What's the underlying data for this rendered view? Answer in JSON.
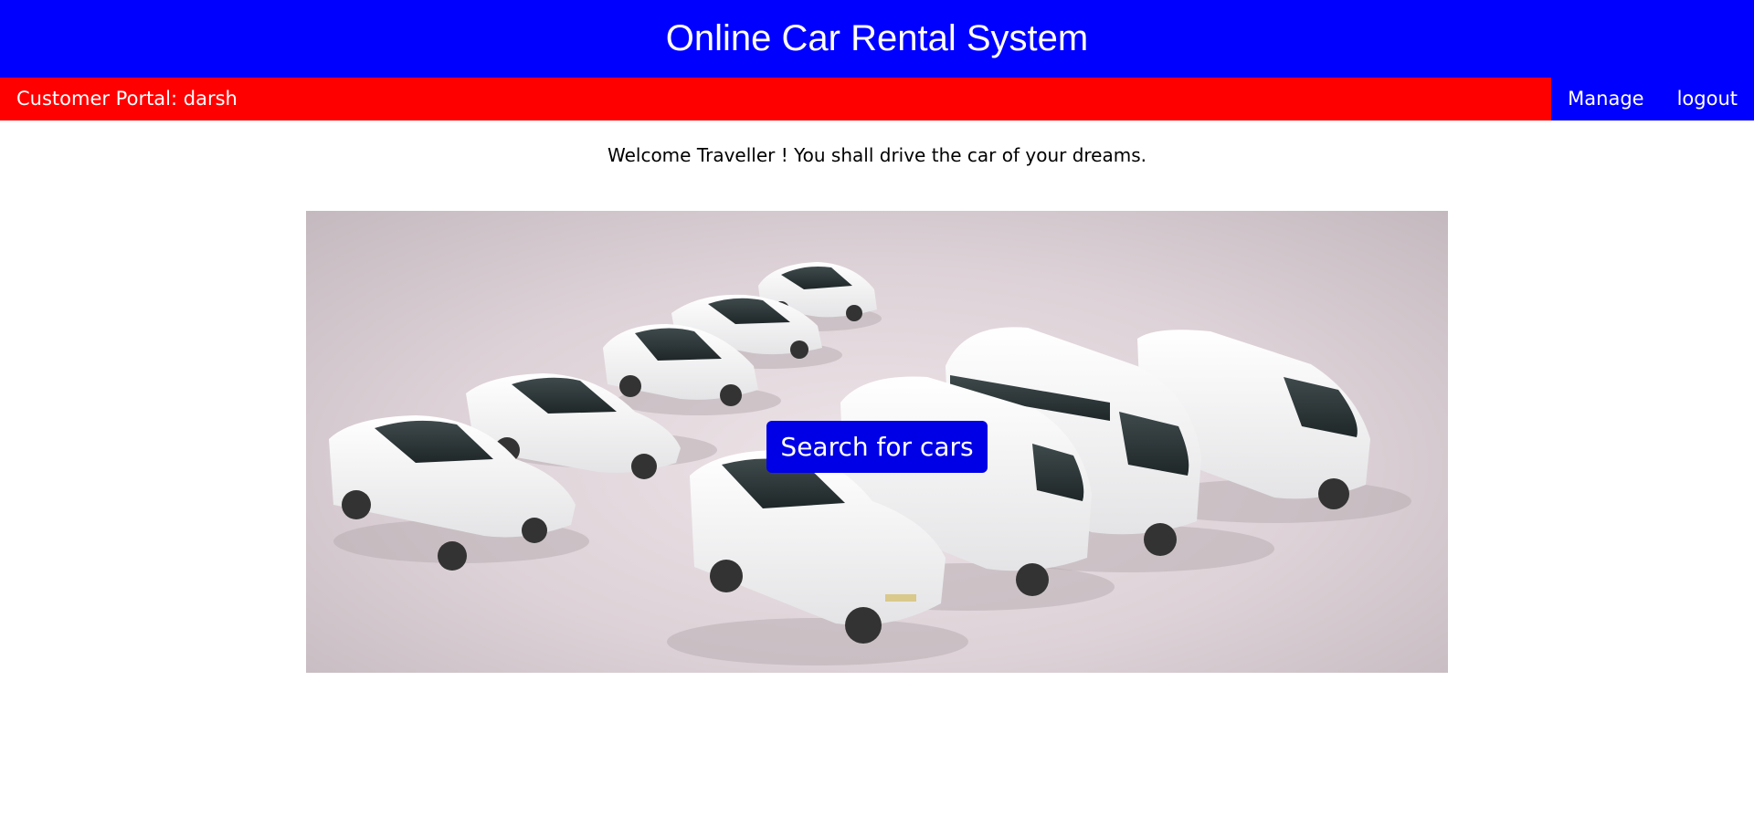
{
  "header": {
    "title": "Online Car Rental System"
  },
  "navbar": {
    "portal_label": "Customer Portal: darsh",
    "links": [
      {
        "label": "Manage"
      },
      {
        "label": "logout"
      }
    ]
  },
  "main": {
    "welcome_text": "Welcome Traveller ! You shall drive the car of your dreams.",
    "search_button_label": "Search for cars"
  },
  "colors": {
    "header_bg": "#0000ff",
    "navbar_bg": "#ff0000",
    "nav_links_bg": "#0000ff",
    "button_bg": "#0000e6"
  }
}
